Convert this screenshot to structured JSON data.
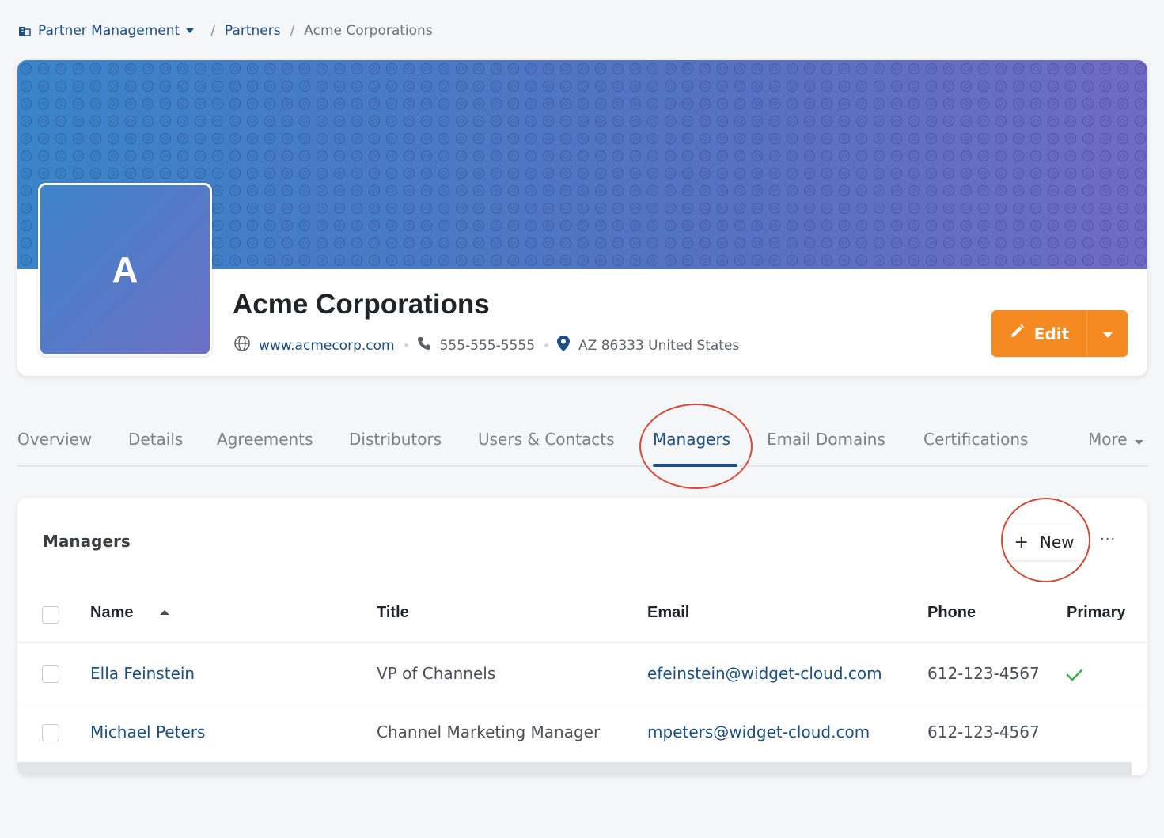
{
  "breadcrumb": {
    "root": "Partner Management",
    "parent": "Partners",
    "current": "Acme Corporations",
    "separator": "/"
  },
  "partner": {
    "avatar_letter": "A",
    "name": "Acme Corporations",
    "website": "www.acmecorp.com",
    "phone": "555-555-5555",
    "location": "AZ 86333 United States"
  },
  "actions": {
    "edit_label": "Edit"
  },
  "tabs": [
    {
      "label": "Overview"
    },
    {
      "label": "Details"
    },
    {
      "label": "Agreements"
    },
    {
      "label": "Distributors"
    },
    {
      "label": "Users & Contacts"
    },
    {
      "label": "Managers",
      "active": true
    },
    {
      "label": "Email Domains"
    },
    {
      "label": "Certifications"
    },
    {
      "label": "More"
    }
  ],
  "managers": {
    "title": "Managers",
    "new_label": "New",
    "more_label": "···",
    "columns": {
      "name": "Name",
      "title": "Title",
      "email": "Email",
      "phone": "Phone",
      "primary": "Primary"
    },
    "rows": [
      {
        "name": "Ella Feinstein",
        "title": "VP of Channels",
        "email": "efeinstein@widget-cloud.com",
        "phone": "612-123-4567",
        "primary": true
      },
      {
        "name": "Michael Peters",
        "title": "Channel Marketing Manager",
        "email": "mpeters@widget-cloud.com",
        "phone": "612-123-4567",
        "primary": false
      }
    ]
  },
  "colors": {
    "accent": "#1c4f82",
    "edit_button": "#f58a22",
    "annotation": "#d24a3a",
    "primary_check": "#3cae4a"
  },
  "icons": {
    "breadcrumb": "building-icon",
    "website": "globe-icon",
    "phone": "phone-icon",
    "location": "map-pin-icon",
    "edit": "pencil-icon",
    "primary": "check-icon"
  }
}
